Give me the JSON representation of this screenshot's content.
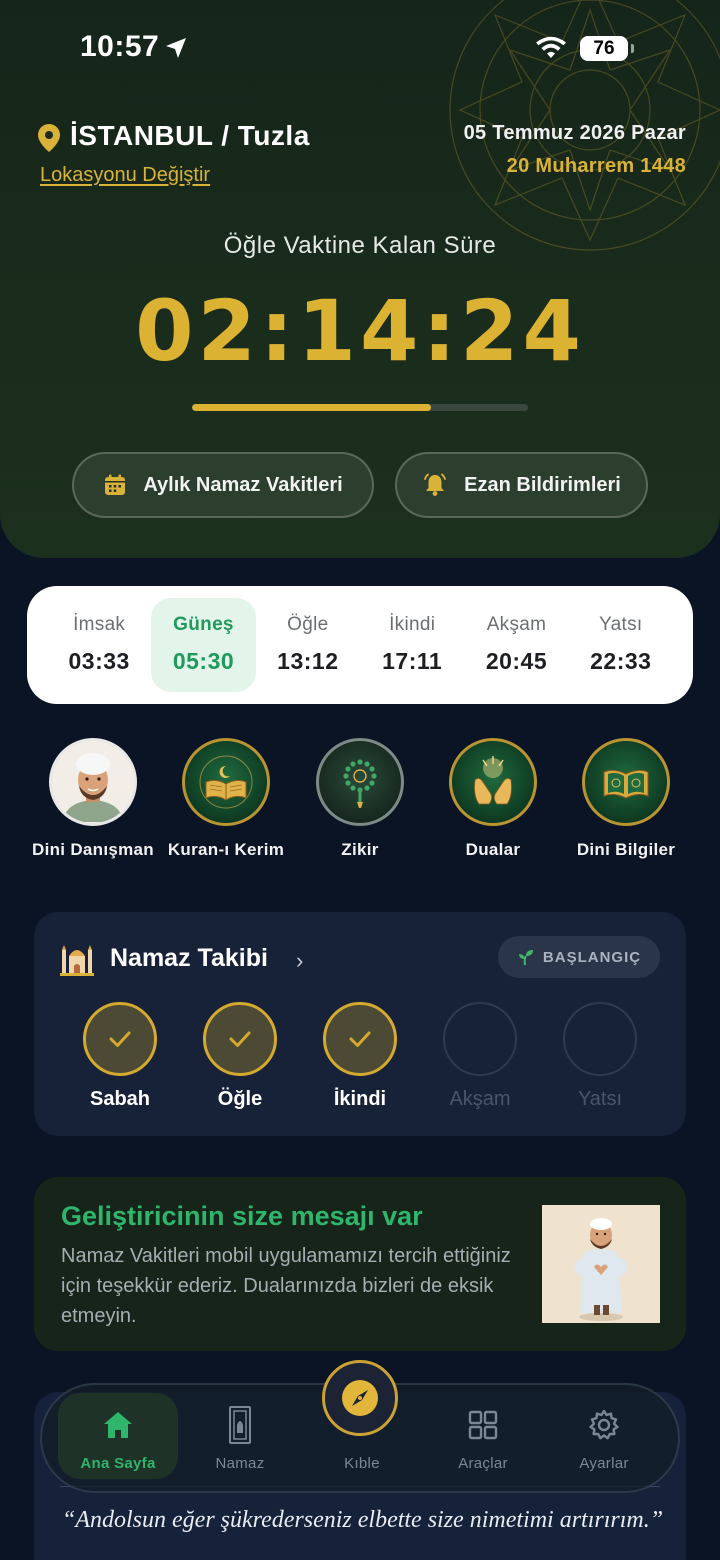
{
  "status_bar": {
    "time": "10:57",
    "battery": "76"
  },
  "location": {
    "city": "İSTANBUL / Tuzla",
    "change_link": "Lokasyonu Değiştir"
  },
  "date": {
    "gregorian": "05 Temmuz 2026 Pazar",
    "hijri": "20 Muharrem 1448"
  },
  "countdown": {
    "label": "Öğle Vaktine Kalan Süre",
    "value": "02:14:24",
    "progress_fraction": 0.71
  },
  "header_buttons": {
    "monthly": "Aylık Namaz Vakitleri",
    "adhan": "Ezan Bildirimleri"
  },
  "prayer_times": [
    {
      "name": "İmsak",
      "time": "03:33",
      "active": false
    },
    {
      "name": "Güneş",
      "time": "05:30",
      "active": true
    },
    {
      "name": "Öğle",
      "time": "13:12",
      "active": false
    },
    {
      "name": "İkindi",
      "time": "17:11",
      "active": false
    },
    {
      "name": "Akşam",
      "time": "20:45",
      "active": false
    },
    {
      "name": "Yatsı",
      "time": "22:33",
      "active": false
    }
  ],
  "shortcuts": [
    {
      "label": "Dini Danışman",
      "icon": "advisor-avatar-icon"
    },
    {
      "label": "Kuran-ı Kerim",
      "icon": "quran-book-icon"
    },
    {
      "label": "Zikir",
      "icon": "prayer-beads-icon"
    },
    {
      "label": "Dualar",
      "icon": "praying-hands-icon"
    },
    {
      "label": "Dini Bilgiler",
      "icon": "religious-info-book-icon"
    }
  ],
  "tracker": {
    "title": "Namaz Takibi",
    "badge": "BAŞLANGIÇ",
    "items": [
      {
        "label": "Sabah",
        "done": true
      },
      {
        "label": "Öğle",
        "done": true
      },
      {
        "label": "İkindi",
        "done": true
      },
      {
        "label": "Akşam",
        "done": false
      },
      {
        "label": "Yatsı",
        "done": false
      }
    ]
  },
  "developer_message": {
    "title": "Geliştiricinin size mesajı var",
    "body": "Namaz Vakitleri mobil uygulamamızı tercih ettiğiniz için teşekkür ederiz. Dualarınızda bizleri de eksik etmeyin."
  },
  "verse": {
    "text": "“Andolsun eğer şükrederseniz elbette size nimetimi artırırım.”"
  },
  "bottom_nav": {
    "home": "Ana Sayfa",
    "namaz": "Namaz",
    "qibla": "Kıble",
    "tools": "Araçlar",
    "settings": "Ayarlar"
  },
  "colors": {
    "gold": "#dcb232",
    "green": "#2fb56c",
    "background": "#0b1424",
    "header": "#1a2c1c"
  }
}
